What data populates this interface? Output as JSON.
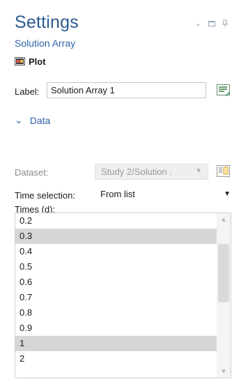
{
  "header": {
    "title": "Settings",
    "subtitle": "Solution Array",
    "plot_label": "Plot"
  },
  "label_field": {
    "label": "Label:",
    "value": "Solution Array 1"
  },
  "section": {
    "title": "Data",
    "state": "expanded"
  },
  "dataset": {
    "label": "Dataset:",
    "value": "Study 2/Solution .",
    "enabled": false
  },
  "time_selection": {
    "label": "Time selection:",
    "value": "From list"
  },
  "times": {
    "label": "Times (d):",
    "items": [
      {
        "value": "0.2",
        "selected": false
      },
      {
        "value": "0.3",
        "selected": true
      },
      {
        "value": "0.4",
        "selected": false
      },
      {
        "value": "0.5",
        "selected": false
      },
      {
        "value": "0.6",
        "selected": false
      },
      {
        "value": "0.7",
        "selected": false
      },
      {
        "value": "0.8",
        "selected": false
      },
      {
        "value": "0.9",
        "selected": false
      },
      {
        "value": "1",
        "selected": true
      },
      {
        "value": "2",
        "selected": false
      }
    ]
  },
  "colors": {
    "title": "#2b5a91",
    "accent": "#2f63a6",
    "selection": "#d6d6d6",
    "disabled_text": "#8a8a8a"
  },
  "icons": {
    "plot": "plot-icon",
    "edit": "edit-label-icon",
    "dataset_action": "dataset-action-icon",
    "collapse": "chevron-down-icon"
  }
}
